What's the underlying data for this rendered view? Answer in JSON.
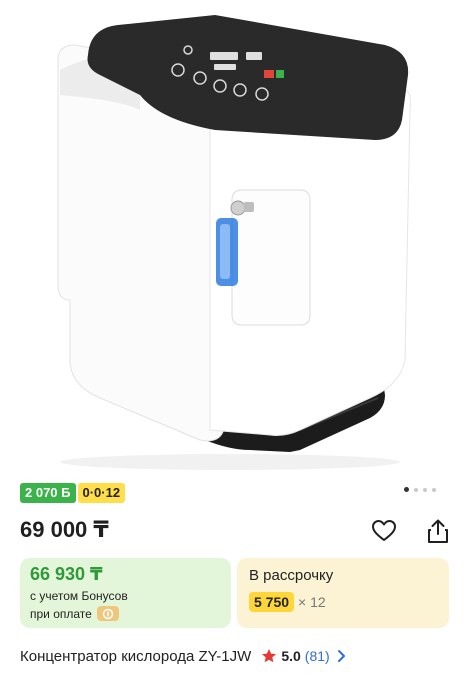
{
  "gallery": {
    "image_alt": "oxygen-concentrator-photo",
    "dots": 4,
    "active_dot": 0
  },
  "tags": {
    "bonus": "2 070 Б",
    "installment": "0·0·12"
  },
  "price": {
    "main": "69 000 ₸"
  },
  "actions": {
    "favorite_icon": "heart-icon",
    "share_icon": "share-icon"
  },
  "bonus_card": {
    "price": "66 930 ₸",
    "line1": "с учетом Бонусов",
    "line2": "при оплате"
  },
  "installment_card": {
    "title": "В рассрочку",
    "amount": "5 750",
    "months": "× 12"
  },
  "product": {
    "title": "Концентратор кислорода ZY-1JW",
    "rating": "5.0",
    "reviews": "(81)"
  },
  "colors": {
    "green": "#3bb34a",
    "yellow": "#ffde4a",
    "star": "#e53935",
    "link": "#2f6fd6"
  }
}
